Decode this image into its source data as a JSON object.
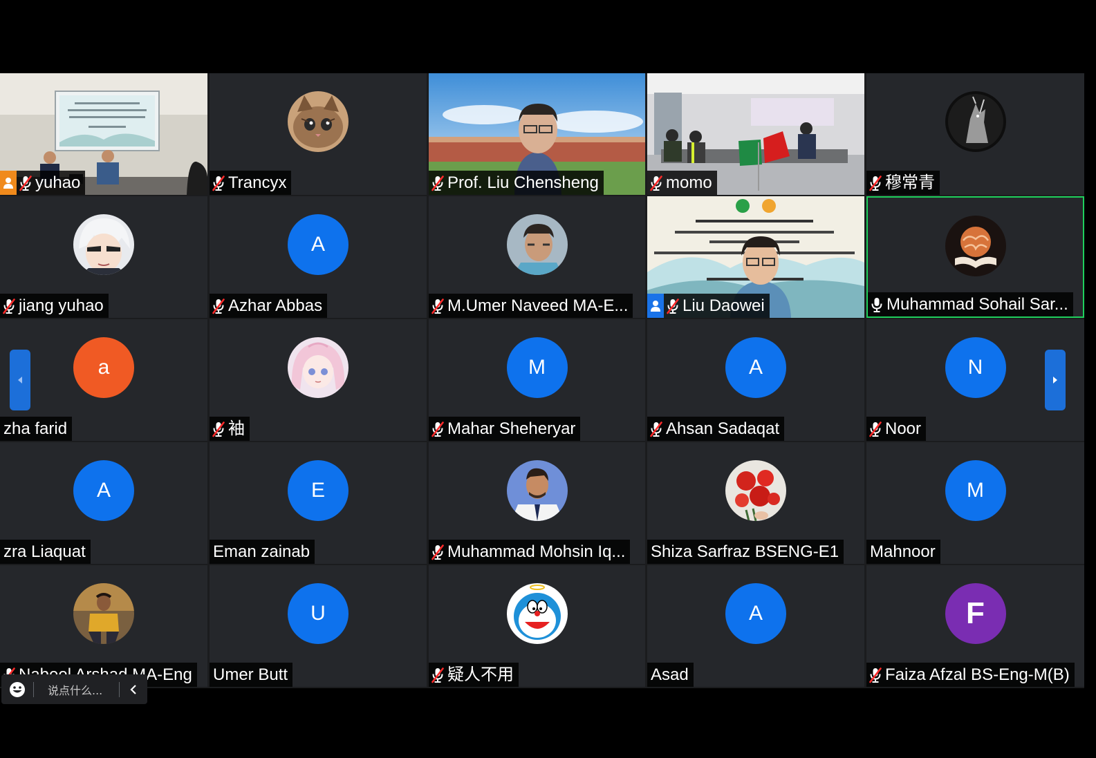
{
  "meeting": {
    "participants": [
      {
        "id": "yuhao",
        "name": "yuhao",
        "type": "video",
        "muted": true,
        "badge": "orange"
      },
      {
        "id": "trancyx",
        "name": "Trancyx",
        "type": "photo",
        "muted": true,
        "photo": "kitten-avatar"
      },
      {
        "id": "liu-chensheng",
        "name": "Prof. Liu Chensheng",
        "type": "video",
        "muted": true
      },
      {
        "id": "momo",
        "name": "momo",
        "type": "video",
        "muted": true
      },
      {
        "id": "mu-changqing",
        "name": "穆常青",
        "type": "photo",
        "muted": true,
        "photo": "wolf-avatar"
      },
      {
        "id": "jiang-yuhao",
        "name": "jiang yuhao",
        "type": "photo",
        "muted": true,
        "photo": "anime-avatar"
      },
      {
        "id": "azhar-abbas",
        "name": "Azhar Abbas",
        "type": "letter",
        "letter": "A",
        "color": "#0e72ed",
        "muted": true
      },
      {
        "id": "umer-naveed",
        "name": "M.Umer Naveed MA-E...",
        "type": "photo",
        "muted": true,
        "photo": "man-avatar"
      },
      {
        "id": "liu-daowei",
        "name": "Liu Daowei",
        "type": "video",
        "muted": true,
        "badge": "blue"
      },
      {
        "id": "sohail-sarwar",
        "name": "Muhammad Sohail Sar...",
        "type": "photo",
        "muted": false,
        "speaking": true,
        "photo": "brain-book-avatar"
      },
      {
        "id": "aizha-farid",
        "name": "zha farid",
        "type": "letter",
        "letter": "a",
        "color": "#f05a24",
        "muted": false
      },
      {
        "id": "you",
        "name": "袖",
        "type": "photo",
        "muted": true,
        "photo": "anime-girl-avatar"
      },
      {
        "id": "mahar-sheheryar",
        "name": "Mahar Sheheryar",
        "type": "letter",
        "letter": "M",
        "color": "#0e72ed",
        "muted": true
      },
      {
        "id": "ahsan-sadaqat",
        "name": "Ahsan Sadaqat",
        "type": "letter",
        "letter": "A",
        "color": "#0e72ed",
        "muted": true
      },
      {
        "id": "noor",
        "name": "Noor",
        "type": "letter",
        "letter": "N",
        "color": "#0e72ed",
        "muted": true
      },
      {
        "id": "azra-liaquat",
        "name": "zra Liaquat",
        "type": "letter",
        "letter": "A",
        "color": "#0e72ed",
        "muted": false
      },
      {
        "id": "eman-zainab",
        "name": "Eman zainab",
        "type": "letter",
        "letter": "E",
        "color": "#0e72ed",
        "muted": false
      },
      {
        "id": "mohsin-iqbal",
        "name": "Muhammad Mohsin Iq...",
        "type": "photo",
        "muted": true,
        "photo": "man-suit-avatar"
      },
      {
        "id": "shiza-sarfraz",
        "name": "Shiza Sarfraz BSENG-E1",
        "type": "photo",
        "muted": false,
        "photo": "flowers-avatar"
      },
      {
        "id": "mahnoor",
        "name": "Mahnoor",
        "type": "letter",
        "letter": "M",
        "color": "#0e72ed",
        "muted": false
      },
      {
        "id": "nabeel-arshad",
        "name": "Nabeel Arshad MA-Eng",
        "type": "photo",
        "muted": true,
        "photo": "man-yellow-avatar"
      },
      {
        "id": "umer-butt",
        "name": "Umer Butt",
        "type": "letter",
        "letter": "U",
        "color": "#0e72ed",
        "muted": false
      },
      {
        "id": "yiren",
        "name": "疑人不用",
        "type": "photo",
        "muted": true,
        "photo": "doraemon-avatar"
      },
      {
        "id": "asad",
        "name": "Asad",
        "type": "letter",
        "letter": "A",
        "color": "#0e72ed",
        "muted": false
      },
      {
        "id": "faiza-afzal",
        "name": "Faiza Afzal BS-Eng-M(B)",
        "type": "letter",
        "letter": "F",
        "color": "#7a2db2",
        "muted": true,
        "big": true
      }
    ]
  },
  "chat": {
    "placeholder": "说点什么..."
  },
  "colors": {
    "tile": "#25272b",
    "speaking": "#1fd05c",
    "accent": "#1c6fd9"
  },
  "icons": {
    "muted": "mic-muted-icon",
    "unmuted": "mic-icon",
    "prev": "chevron-left-icon",
    "next": "chevron-right-icon",
    "emoji": "emoji-icon"
  }
}
